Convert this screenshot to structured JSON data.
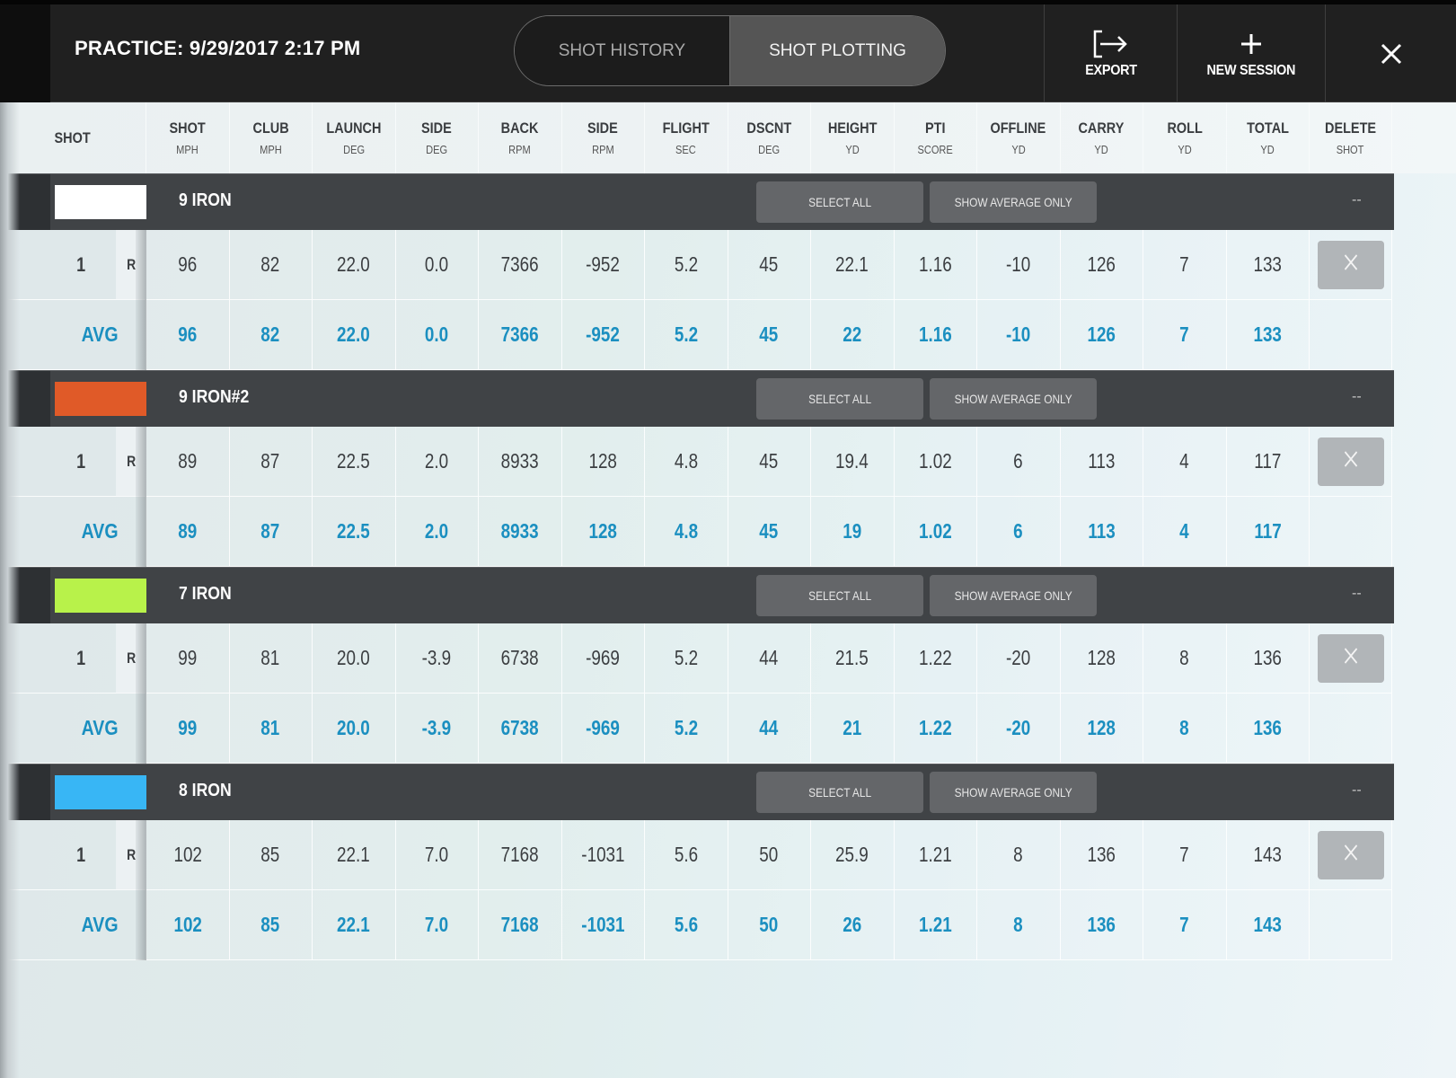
{
  "header": {
    "title": "PRACTICE: 9/29/2017 2:17 PM",
    "tabs": [
      {
        "label": "SHOT HISTORY",
        "active": false
      },
      {
        "label": "SHOT PLOTTING",
        "active": true
      }
    ],
    "actions": {
      "export_label": "EXPORT",
      "export_icon": "export-icon",
      "new_session_label": "NEW SESSION",
      "new_session_icon": "plus-icon",
      "close_icon": "close-icon"
    }
  },
  "columns": [
    {
      "title": "SHOT",
      "unit": ""
    },
    {
      "title": "SHOT",
      "unit": "MPH"
    },
    {
      "title": "CLUB",
      "unit": "MPH"
    },
    {
      "title": "LAUNCH",
      "unit": "DEG"
    },
    {
      "title": "SIDE",
      "unit": "DEG"
    },
    {
      "title": "BACK",
      "unit": "RPM"
    },
    {
      "title": "SIDE",
      "unit": "RPM"
    },
    {
      "title": "FLIGHT",
      "unit": "SEC"
    },
    {
      "title": "DSCNT",
      "unit": "DEG"
    },
    {
      "title": "HEIGHT",
      "unit": "YD"
    },
    {
      "title": "PTI",
      "unit": "SCORE"
    },
    {
      "title": "OFFLINE",
      "unit": "YD"
    },
    {
      "title": "CARRY",
      "unit": "YD"
    },
    {
      "title": "ROLL",
      "unit": "YD"
    },
    {
      "title": "TOTAL",
      "unit": "YD"
    },
    {
      "title": "DELETE",
      "unit": "SHOT"
    }
  ],
  "group_buttons": {
    "select_all": "SELECT ALL",
    "show_average_only": "SHOW AVERAGE ONLY",
    "collapse": "--"
  },
  "avg_label": "AVG",
  "groups": [
    {
      "name": "9 IRON",
      "color": "#ffffff",
      "shots": [
        {
          "number": "1",
          "hand": "R",
          "values": [
            "96",
            "82",
            "22.0",
            "0.0",
            "7366",
            "-952",
            "5.2",
            "45",
            "22.1",
            "1.16",
            "-10",
            "126",
            "7",
            "133"
          ]
        }
      ],
      "average": [
        "96",
        "82",
        "22.0",
        "0.0",
        "7366",
        "-952",
        "5.2",
        "45",
        "22",
        "1.16",
        "-10",
        "126",
        "7",
        "133"
      ]
    },
    {
      "name": "9 IRON#2",
      "color": "#e05a28",
      "shots": [
        {
          "number": "1",
          "hand": "R",
          "values": [
            "89",
            "87",
            "22.5",
            "2.0",
            "8933",
            "128",
            "4.8",
            "45",
            "19.4",
            "1.02",
            "6",
            "113",
            "4",
            "117"
          ]
        }
      ],
      "average": [
        "89",
        "87",
        "22.5",
        "2.0",
        "8933",
        "128",
        "4.8",
        "45",
        "19",
        "1.02",
        "6",
        "113",
        "4",
        "117"
      ]
    },
    {
      "name": "7 IRON",
      "color": "#b8f24a",
      "shots": [
        {
          "number": "1",
          "hand": "R",
          "values": [
            "99",
            "81",
            "20.0",
            "-3.9",
            "6738",
            "-969",
            "5.2",
            "44",
            "21.5",
            "1.22",
            "-20",
            "128",
            "8",
            "136"
          ]
        }
      ],
      "average": [
        "99",
        "81",
        "20.0",
        "-3.9",
        "6738",
        "-969",
        "5.2",
        "44",
        "21",
        "1.22",
        "-20",
        "128",
        "8",
        "136"
      ]
    },
    {
      "name": "8 IRON",
      "color": "#38b6f5",
      "shots": [
        {
          "number": "1",
          "hand": "R",
          "values": [
            "102",
            "85",
            "22.1",
            "7.0",
            "7168",
            "-1031",
            "5.6",
            "50",
            "25.9",
            "1.21",
            "8",
            "136",
            "7",
            "143"
          ]
        }
      ],
      "average": [
        "102",
        "85",
        "22.1",
        "7.0",
        "7168",
        "-1031",
        "5.6",
        "50",
        "26",
        "1.21",
        "8",
        "136",
        "7",
        "143"
      ]
    }
  ]
}
